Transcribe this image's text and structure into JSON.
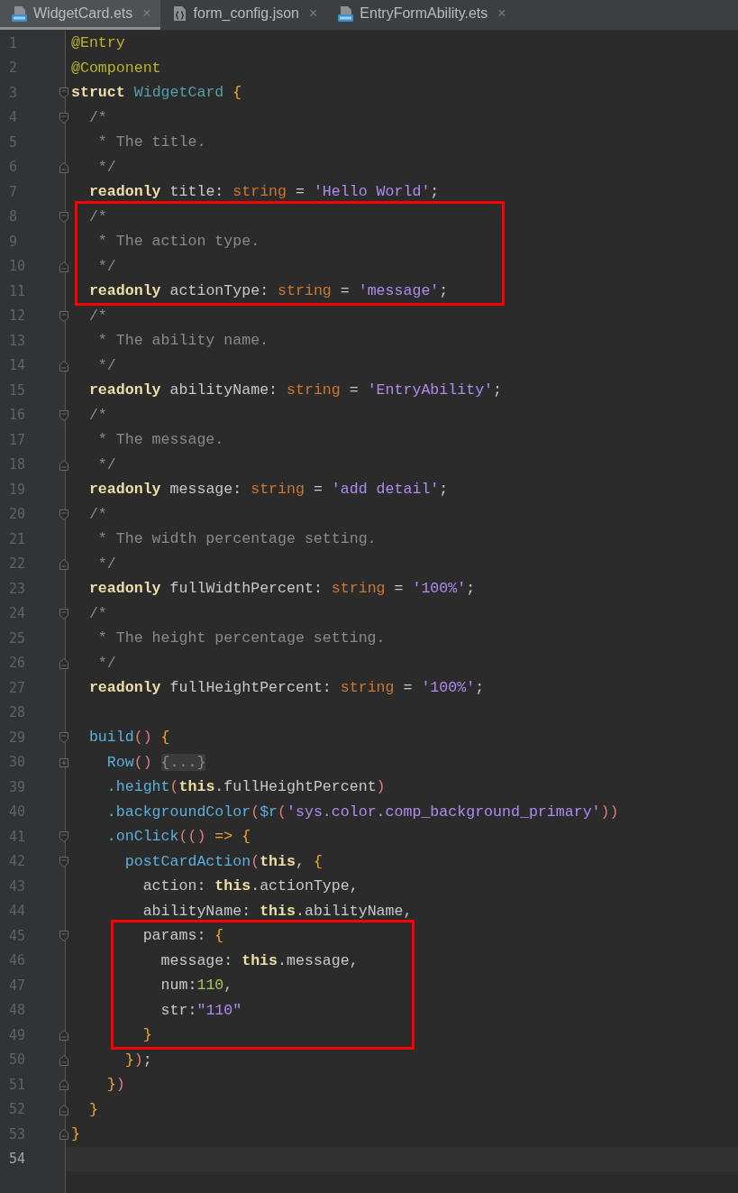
{
  "tabs": [
    {
      "label": "WidgetCard.ets",
      "kind": "ets",
      "selected": true,
      "close": "×"
    },
    {
      "label": "form_config.json",
      "kind": "json",
      "selected": false,
      "close": "×"
    },
    {
      "label": "EntryFormAbility.ets",
      "kind": "ets",
      "selected": false,
      "close": "×"
    }
  ],
  "lines": [
    {
      "number": "1",
      "kind": "plain",
      "tokens": [
        {
          "text": "@Entry",
          "kind": "ann"
        }
      ]
    },
    {
      "number": "2",
      "kind": "plain",
      "tokens": [
        {
          "text": "@Component",
          "kind": "ann"
        }
      ]
    },
    {
      "number": "3",
      "kind": "fold-start",
      "tokens": [
        {
          "text": "struct ",
          "kind": "kw"
        },
        {
          "text": "WidgetCard ",
          "kind": "type"
        },
        {
          "text": "{",
          "kind": "brace"
        }
      ]
    },
    {
      "number": "4",
      "kind": "fold-start",
      "tokens": [
        {
          "text": "  /*",
          "kind": "comment"
        }
      ]
    },
    {
      "number": "5",
      "kind": "plain",
      "tokens": [
        {
          "text": "   * The title.",
          "kind": "comment"
        }
      ]
    },
    {
      "number": "6",
      "kind": "fold-end",
      "tokens": [
        {
          "text": "   */",
          "kind": "comment"
        }
      ]
    },
    {
      "number": "7",
      "kind": "plain",
      "tokens": [
        {
          "text": "  readonly",
          "kind": "kw"
        },
        {
          "text": " title: ",
          "kind": "plain"
        },
        {
          "text": "string",
          "kind": "builtin"
        },
        {
          "text": " = ",
          "kind": "plain"
        },
        {
          "text": "'Hello World'",
          "kind": "str"
        },
        {
          "text": ";",
          "kind": "plain"
        }
      ]
    },
    {
      "number": "8",
      "kind": "fold-start",
      "boxed": true,
      "tokens": [
        {
          "text": "  /*",
          "kind": "comment"
        }
      ]
    },
    {
      "number": "9",
      "kind": "plain",
      "boxed": true,
      "tokens": [
        {
          "text": "   * The action type.",
          "kind": "comment"
        }
      ]
    },
    {
      "number": "10",
      "kind": "fold-end",
      "boxed": true,
      "tokens": [
        {
          "text": "   */",
          "kind": "comment"
        }
      ]
    },
    {
      "number": "11",
      "kind": "plain",
      "boxed": true,
      "tokens": [
        {
          "text": "  readonly",
          "kind": "kw"
        },
        {
          "text": " actionType: ",
          "kind": "plain"
        },
        {
          "text": "string",
          "kind": "builtin"
        },
        {
          "text": " = ",
          "kind": "plain"
        },
        {
          "text": "'message'",
          "kind": "str"
        },
        {
          "text": ";",
          "kind": "plain"
        }
      ]
    },
    {
      "number": "12",
      "kind": "fold-start",
      "tokens": [
        {
          "text": "  /*",
          "kind": "comment"
        }
      ]
    },
    {
      "number": "13",
      "kind": "plain",
      "tokens": [
        {
          "text": "   * The ability name.",
          "kind": "comment"
        }
      ]
    },
    {
      "number": "14",
      "kind": "fold-end",
      "tokens": [
        {
          "text": "   */",
          "kind": "comment"
        }
      ]
    },
    {
      "number": "15",
      "kind": "plain",
      "tokens": [
        {
          "text": "  readonly",
          "kind": "kw"
        },
        {
          "text": " abilityName: ",
          "kind": "plain"
        },
        {
          "text": "string",
          "kind": "builtin"
        },
        {
          "text": " = ",
          "kind": "plain"
        },
        {
          "text": "'EntryAbility'",
          "kind": "str"
        },
        {
          "text": ";",
          "kind": "plain"
        }
      ]
    },
    {
      "number": "16",
      "kind": "fold-start",
      "tokens": [
        {
          "text": "  /*",
          "kind": "comment"
        }
      ]
    },
    {
      "number": "17",
      "kind": "plain",
      "tokens": [
        {
          "text": "   * The message.",
          "kind": "comment"
        }
      ]
    },
    {
      "number": "18",
      "kind": "fold-end",
      "tokens": [
        {
          "text": "   */",
          "kind": "comment"
        }
      ]
    },
    {
      "number": "19",
      "kind": "plain",
      "tokens": [
        {
          "text": "  readonly",
          "kind": "kw"
        },
        {
          "text": " message: ",
          "kind": "plain"
        },
        {
          "text": "string",
          "kind": "builtin"
        },
        {
          "text": " = ",
          "kind": "plain"
        },
        {
          "text": "'add detail'",
          "kind": "str"
        },
        {
          "text": ";",
          "kind": "plain"
        }
      ]
    },
    {
      "number": "20",
      "kind": "fold-start",
      "tokens": [
        {
          "text": "  /*",
          "kind": "comment"
        }
      ]
    },
    {
      "number": "21",
      "kind": "plain",
      "tokens": [
        {
          "text": "   * The width percentage setting.",
          "kind": "comment"
        }
      ]
    },
    {
      "number": "22",
      "kind": "fold-end",
      "tokens": [
        {
          "text": "   */",
          "kind": "comment"
        }
      ]
    },
    {
      "number": "23",
      "kind": "plain",
      "tokens": [
        {
          "text": "  readonly",
          "kind": "kw"
        },
        {
          "text": " fullWidthPercent: ",
          "kind": "plain"
        },
        {
          "text": "string",
          "kind": "builtin"
        },
        {
          "text": " = ",
          "kind": "plain"
        },
        {
          "text": "'100%'",
          "kind": "str"
        },
        {
          "text": ";",
          "kind": "plain"
        }
      ]
    },
    {
      "number": "24",
      "kind": "fold-start",
      "tokens": [
        {
          "text": "  /*",
          "kind": "comment"
        }
      ]
    },
    {
      "number": "25",
      "kind": "plain",
      "tokens": [
        {
          "text": "   * The height percentage setting.",
          "kind": "comment"
        }
      ]
    },
    {
      "number": "26",
      "kind": "fold-end",
      "tokens": [
        {
          "text": "   */",
          "kind": "comment"
        }
      ]
    },
    {
      "number": "27",
      "kind": "plain",
      "tokens": [
        {
          "text": "  readonly",
          "kind": "kw"
        },
        {
          "text": " fullHeightPercent: ",
          "kind": "plain"
        },
        {
          "text": "string",
          "kind": "builtin"
        },
        {
          "text": " = ",
          "kind": "plain"
        },
        {
          "text": "'100%'",
          "kind": "str"
        },
        {
          "text": ";",
          "kind": "plain"
        }
      ]
    },
    {
      "number": "28",
      "kind": "plain"
    },
    {
      "number": "29",
      "kind": "fold-start",
      "tokens": [
        {
          "text": "  build",
          "kind": "method"
        },
        {
          "text": "() ",
          "kind": "paren"
        },
        {
          "text": "{",
          "kind": "brace"
        }
      ]
    },
    {
      "number": "30",
      "kind": "fold-collapsed",
      "tokens": [
        {
          "text": "    Row",
          "kind": "method"
        },
        {
          "text": "() ",
          "kind": "paren"
        },
        {
          "text": "{...}",
          "kind": "folded"
        }
      ]
    },
    {
      "number": "39",
      "kind": "plain",
      "tokens": [
        {
          "text": "    .height",
          "kind": "method"
        },
        {
          "text": "(",
          "kind": "paren"
        },
        {
          "text": "this",
          "kind": "kw"
        },
        {
          "text": ".fullHeightPercent",
          "kind": "plain"
        },
        {
          "text": ")",
          "kind": "paren"
        }
      ]
    },
    {
      "number": "40",
      "kind": "plain",
      "tokens": [
        {
          "text": "    .backgroundColor",
          "kind": "method"
        },
        {
          "text": "(",
          "kind": "paren"
        },
        {
          "text": "$r",
          "kind": "method"
        },
        {
          "text": "(",
          "kind": "paren"
        },
        {
          "text": "'sys.color.comp_background_primary'",
          "kind": "str"
        },
        {
          "text": "))",
          "kind": "paren"
        }
      ]
    },
    {
      "number": "41",
      "kind": "fold-start",
      "tokens": [
        {
          "text": "    .onClick",
          "kind": "method"
        },
        {
          "text": "(",
          "kind": "paren"
        },
        {
          "text": "()",
          "kind": "paren"
        },
        {
          "text": " => {",
          "kind": "brace"
        }
      ]
    },
    {
      "number": "42",
      "kind": "fold-start",
      "tokens": [
        {
          "text": "      postCardAction",
          "kind": "method"
        },
        {
          "text": "(",
          "kind": "paren"
        },
        {
          "text": "this",
          "kind": "kw"
        },
        {
          "text": ", ",
          "kind": "plain"
        },
        {
          "text": "{",
          "kind": "brace"
        }
      ]
    },
    {
      "number": "43",
      "kind": "plain",
      "tokens": [
        {
          "text": "        action: ",
          "kind": "plain"
        },
        {
          "text": "this",
          "kind": "kw"
        },
        {
          "text": ".actionType,",
          "kind": "plain"
        }
      ]
    },
    {
      "number": "44",
      "kind": "plain",
      "tokens": [
        {
          "text": "        abilityName: ",
          "kind": "plain"
        },
        {
          "text": "this",
          "kind": "kw"
        },
        {
          "text": ".abilityName,",
          "kind": "plain"
        }
      ]
    },
    {
      "number": "45",
      "kind": "fold-start",
      "boxed": true,
      "tokens": [
        {
          "text": "        params: ",
          "kind": "plain"
        },
        {
          "text": "{",
          "kind": "brace"
        }
      ]
    },
    {
      "number": "46",
      "kind": "plain",
      "boxed": true,
      "tokens": [
        {
          "text": "          message: ",
          "kind": "plain"
        },
        {
          "text": "this",
          "kind": "kw"
        },
        {
          "text": ".message,",
          "kind": "plain"
        }
      ]
    },
    {
      "number": "47",
      "kind": "plain",
      "boxed": true,
      "tokens": [
        {
          "text": "          num:",
          "kind": "plain"
        },
        {
          "text": "110",
          "kind": "num"
        },
        {
          "text": ",",
          "kind": "plain"
        }
      ]
    },
    {
      "number": "48",
      "kind": "plain",
      "boxed": true,
      "tokens": [
        {
          "text": "          str:",
          "kind": "plain"
        },
        {
          "text": "\"110\"",
          "kind": "str"
        }
      ]
    },
    {
      "number": "49",
      "kind": "fold-end",
      "boxed": true,
      "tokens": [
        {
          "text": "        }",
          "kind": "brace"
        }
      ]
    },
    {
      "number": "50",
      "kind": "fold-end",
      "tokens": [
        {
          "text": "      }",
          "kind": "brace"
        },
        {
          "text": ")",
          "kind": "paren"
        },
        {
          "text": ";",
          "kind": "plain"
        }
      ]
    },
    {
      "number": "51",
      "kind": "fold-end",
      "tokens": [
        {
          "text": "    }",
          "kind": "brace"
        },
        {
          "text": ")",
          "kind": "paren"
        }
      ]
    },
    {
      "number": "52",
      "kind": "fold-end",
      "tokens": [
        {
          "text": "  }",
          "kind": "brace"
        }
      ]
    },
    {
      "number": "53",
      "kind": "fold-end",
      "tokens": [
        {
          "text": "}",
          "kind": "brace"
        }
      ]
    },
    {
      "number": "54",
      "kind": "plain",
      "current": true
    }
  ]
}
